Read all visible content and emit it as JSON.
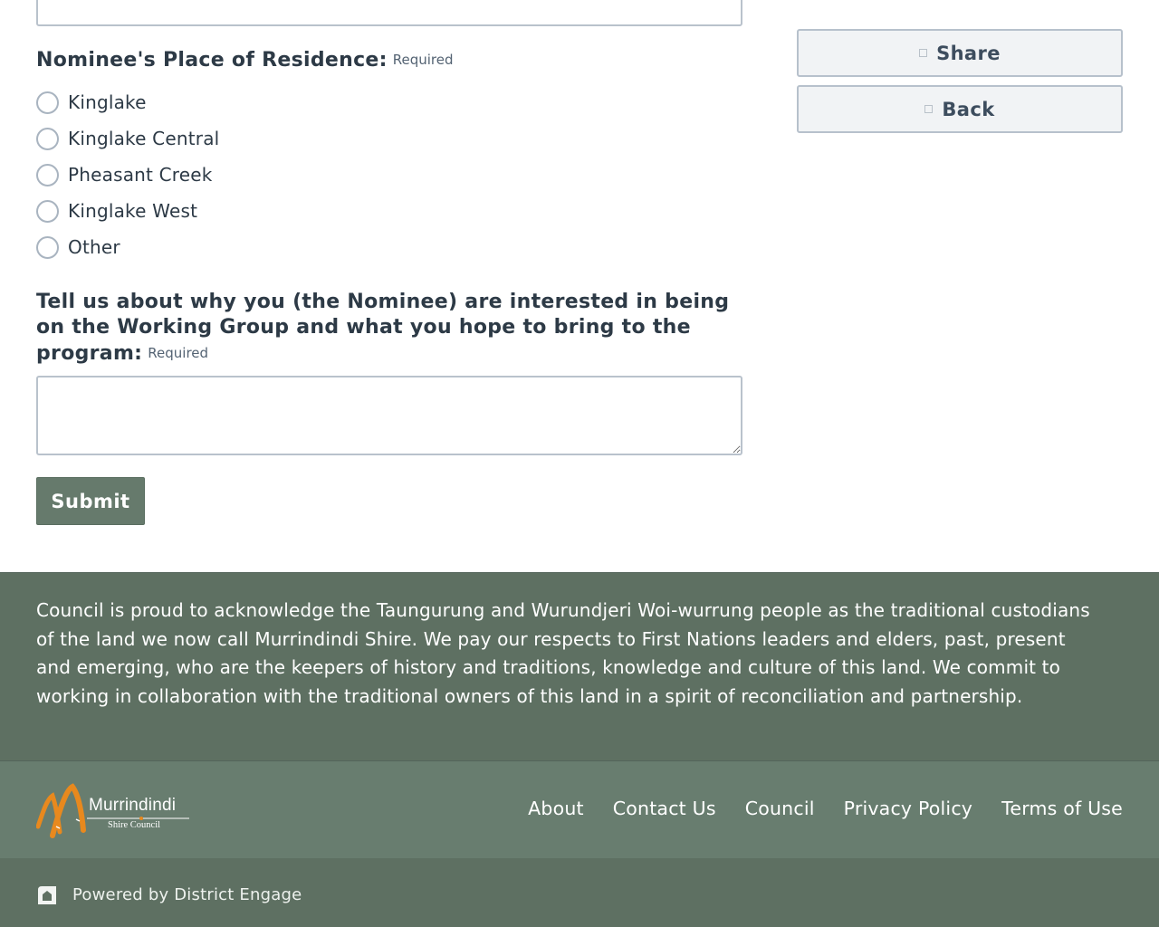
{
  "form": {
    "residence_question": "Nominee's Place of Residence:",
    "required_label": "Required",
    "residence_options": [
      {
        "label": "Kinglake"
      },
      {
        "label": "Kinglake Central"
      },
      {
        "label": "Pheasant Creek"
      },
      {
        "label": "Kinglake West"
      },
      {
        "label": "Other"
      }
    ],
    "interest_question": "Tell us about why you (the Nominee) are interested in being on the Working Group and what you hope to bring to the program:",
    "interest_value": "",
    "submit_label": "Submit"
  },
  "sidebar": {
    "share_label": "Share",
    "back_label": "Back"
  },
  "footer": {
    "acknowledgement": "Council is proud to acknowledge the Taungurung and Wurundjeri Woi-wurrung people as the traditional custodians of the land we now call Murrindindi Shire. We pay our respects to First Nations leaders and elders, past, present and emerging, who are the keepers of history and traditions, knowledge and culture of this land. We commit to working in collaboration with the traditional owners of this land in a spirit of reconciliation and partnership.",
    "logo_name": "Murrindindi",
    "logo_sub": "Shire Council",
    "links": [
      {
        "label": "About"
      },
      {
        "label": "Contact Us"
      },
      {
        "label": "Council"
      },
      {
        "label": "Privacy Policy"
      },
      {
        "label": "Terms of Use"
      }
    ],
    "powered_by": "Powered by District Engage"
  },
  "colors": {
    "accent_green": "#667a6c",
    "footer_dark": "#5e7062",
    "text_dark": "#2d3a46",
    "logo_orange": "#e8891e"
  }
}
